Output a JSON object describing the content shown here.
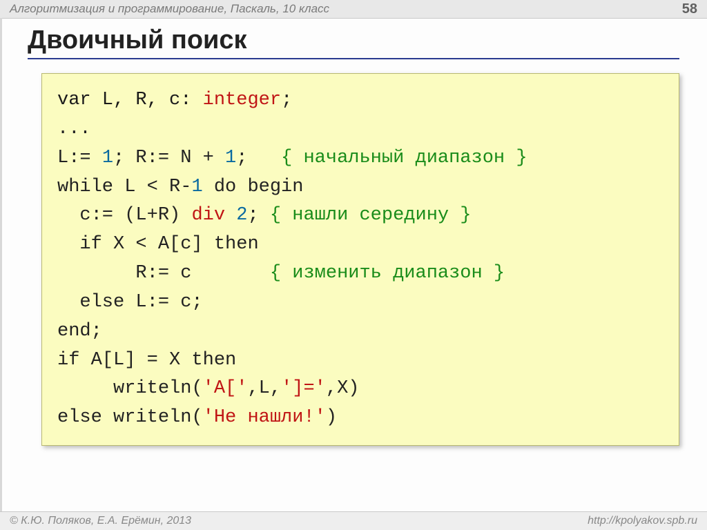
{
  "header": {
    "breadcrumb": "Алгоритмизация и программирование, Паскаль, 10 класс",
    "page_number": "58"
  },
  "title": "Двоичный поиск",
  "code": {
    "l1_a": "var L, R, c: ",
    "l1_type": "integer",
    "l1_b": ";",
    "l2": "...",
    "l3_a": "L:= ",
    "l3_n1": "1",
    "l3_b": "; R:= N + ",
    "l3_n2": "1",
    "l3_c": ";   ",
    "l3_cm": "{ начальный диапазон }",
    "l4_a": "while L < R-",
    "l4_n1": "1",
    "l4_b": " do begin",
    "l5_a": "  c:= (L+R) ",
    "l5_op": "div",
    "l5_sp": " ",
    "l5_n1": "2",
    "l5_b": "; ",
    "l5_cm": "{ нашли середину }",
    "l6": "  if X < A[c] then",
    "l7_a": "       R:= c       ",
    "l7_cm": "{ изменить диапазон }",
    "l8": "  else L:= c;",
    "l9": "end;",
    "l10": "if A[L] = X then",
    "l11_a": "     writeln(",
    "l11_s1": "'A['",
    "l11_b": ",L,",
    "l11_s2": "']='",
    "l11_c": ",X)",
    "l12_a": "else writeln(",
    "l12_s1": "'Не нашли!'",
    "l12_b": ")"
  },
  "footer": {
    "copyright": "© К.Ю. Поляков, Е.А. Ерёмин, 2013",
    "url": "http://kpolyakov.spb.ru"
  }
}
